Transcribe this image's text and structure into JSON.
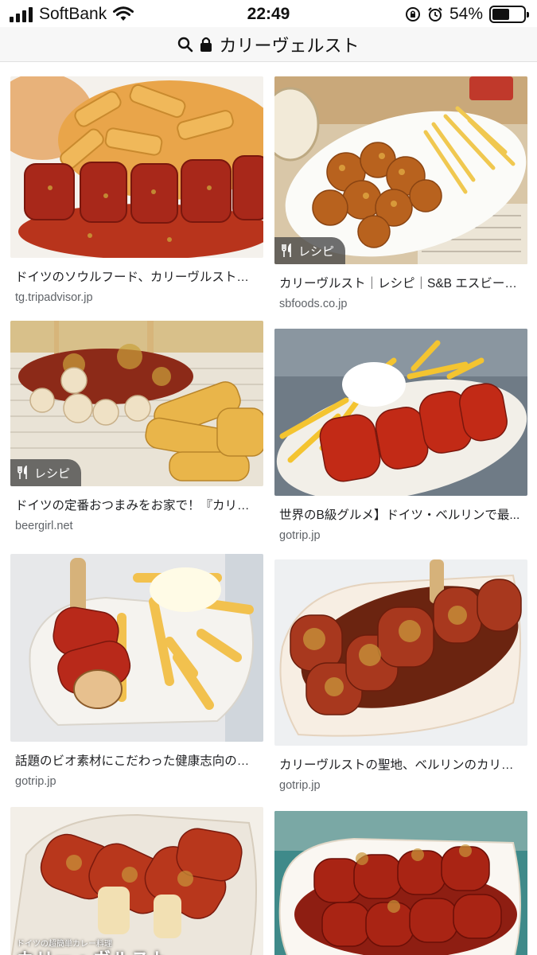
{
  "status_bar": {
    "carrier": "SoftBank",
    "time": "22:49",
    "battery_percent": "54%",
    "battery_level": 0.54
  },
  "url_bar": {
    "query": "カリーヴェルスト"
  },
  "results": [
    {
      "title": "ドイツのソウルフード、カリーヴルストが...",
      "source": "tg.tripadvisor.jp",
      "badge": ""
    },
    {
      "title": "カリーヴルスト｜レシピ｜S&B エスビー食...",
      "source": "sbfoods.co.jp",
      "badge": "レシピ"
    },
    {
      "title": "ドイツの定番おつまみをお家で！『カリー...",
      "source": "beergirl.net",
      "badge": "レシピ"
    },
    {
      "title": "世界のB級グルメ】ドイツ・ベルリンで最...",
      "source": "gotrip.jp",
      "badge": ""
    },
    {
      "title": "話題のビオ素材にこだわった健康志向のカ...",
      "source": "gotrip.jp",
      "badge": ""
    },
    {
      "title": "カリーヴルストの聖地、ベルリンのカリー...",
      "source": "gotrip.jp",
      "badge": ""
    },
    {
      "title": "",
      "source": "",
      "badge": ""
    },
    {
      "title": "",
      "source": "",
      "badge": ""
    }
  ],
  "image_texts": {
    "result_7_caption_small": "ドイツの超簡単カレー料理",
    "result_7_caption_large": "カリー・ヴルスト"
  },
  "icons": [
    "signal-icon",
    "wifi-icon",
    "search-icon",
    "lock-icon",
    "orientation-lock-icon",
    "alarm-icon",
    "battery-icon",
    "utensils-icon"
  ]
}
